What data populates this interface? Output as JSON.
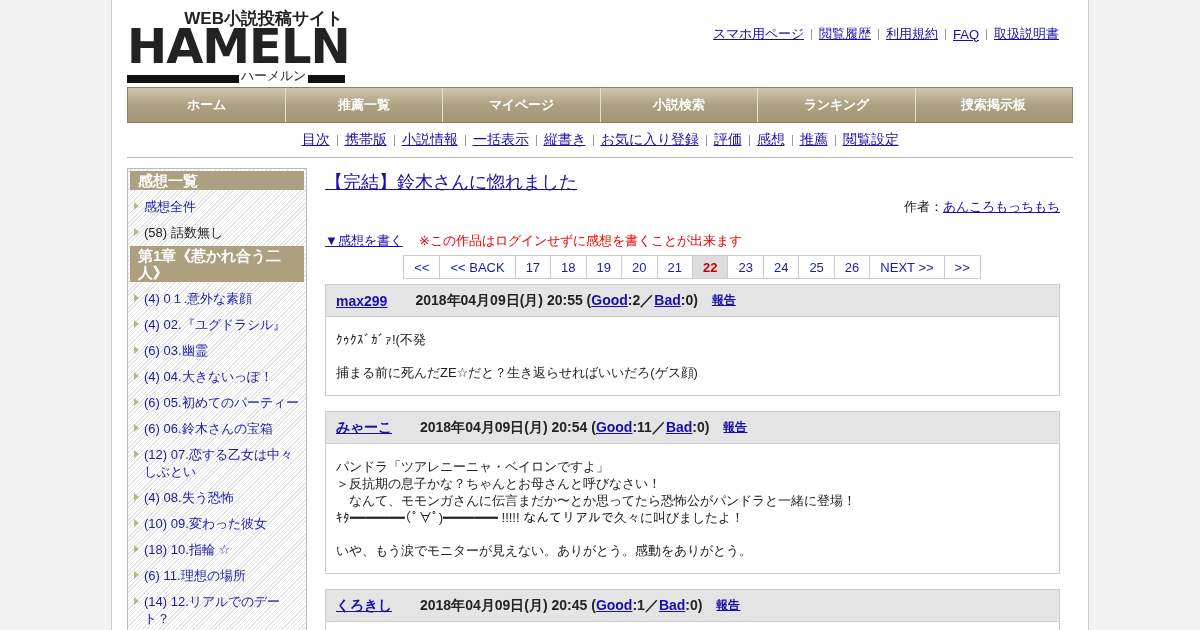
{
  "logo": {
    "tagline": "WEB小説投稿サイト",
    "name": "HAMELN",
    "reading": "ハーメルン"
  },
  "top_links": [
    "スマホ用ページ",
    "閲覧履歴",
    "利用規約",
    "FAQ",
    "取扱説明書"
  ],
  "nav": [
    "ホーム",
    "推薦一覧",
    "マイページ",
    "小説検索",
    "ランキング",
    "捜索掲示板"
  ],
  "sub_nav": [
    "目次",
    "携帯版",
    "小説情報",
    "一括表示",
    "縦書き",
    "お気に入り登録",
    "評価",
    "感想",
    "推薦",
    "閲覧設定"
  ],
  "sidebar": [
    {
      "heading": "感想一覧",
      "items": [
        {
          "text": "感想全件",
          "link": true
        },
        {
          "text": "(58) 話数無し",
          "link": false
        }
      ]
    },
    {
      "heading": "第1章《惹かれ合う二人》",
      "items": [
        {
          "text": "(4) 0１.意外な素顔",
          "link": true
        },
        {
          "text": "(4) 02.『ユグドラシル』",
          "link": true
        },
        {
          "text": "(6) 03.幽霊",
          "link": true
        },
        {
          "text": "(4) 04.大きないっぽ！",
          "link": true
        },
        {
          "text": "(6) 05.初めてのパーティー",
          "link": true
        },
        {
          "text": "(6) 06.鈴木さんの宝箱",
          "link": true
        },
        {
          "text": "(12) 07.恋する乙女は中々しぶとい",
          "link": true
        },
        {
          "text": "(4) 08.失う恐怖",
          "link": true
        },
        {
          "text": "(10) 09.変わった彼女",
          "link": true
        },
        {
          "text": "(18) 10.指輪 ☆",
          "link": true
        },
        {
          "text": "(6) 11.理想の場所",
          "link": true
        },
        {
          "text": "(14) 12.リアルでのデート？",
          "link": true
        }
      ]
    }
  ],
  "title": "【完結】鈴木さんに惚れました",
  "author_label": "作者：",
  "author": "あんころもっちもち",
  "write_link": "▼感想を書く",
  "notice": "※この作品はログインせずに感想を書くことが出来ます",
  "pagination": [
    {
      "label": "<<",
      "selected": false
    },
    {
      "label": "<< BACK",
      "selected": false
    },
    {
      "label": "17",
      "selected": false
    },
    {
      "label": "18",
      "selected": false
    },
    {
      "label": "19",
      "selected": false
    },
    {
      "label": "20",
      "selected": false
    },
    {
      "label": "21",
      "selected": false
    },
    {
      "label": "22",
      "selected": true
    },
    {
      "label": "23",
      "selected": false
    },
    {
      "label": "24",
      "selected": false
    },
    {
      "label": "25",
      "selected": false
    },
    {
      "label": "26",
      "selected": false
    },
    {
      "label": "NEXT >>",
      "selected": false
    },
    {
      "label": ">>",
      "selected": false
    }
  ],
  "comments": [
    {
      "user": "max299",
      "meta": [
        {
          "kind": "text",
          "text": "2018年04月09日(月) 20:55 ("
        },
        {
          "kind": "link",
          "text": "Good"
        },
        {
          "kind": "text",
          "text": ":2／"
        },
        {
          "kind": "link",
          "text": "Bad"
        },
        {
          "kind": "text",
          "text": ":0)"
        }
      ],
      "report": "報告",
      "body": [
        [
          "ｸｩｸｽﾞｶﾞｧ!(不発"
        ],
        [
          "捕まる前に死んだZE☆だと？生き返らせればいいだろ(ゲス顔)"
        ]
      ]
    },
    {
      "user": "みゃーこ",
      "meta": [
        {
          "kind": "text",
          "text": "2018年04月09日(月) 20:54 ("
        },
        {
          "kind": "link",
          "text": "Good"
        },
        {
          "kind": "text",
          "text": ":11／"
        },
        {
          "kind": "link",
          "text": "Bad"
        },
        {
          "kind": "text",
          "text": ":0)"
        }
      ],
      "report": "報告",
      "body": [
        [
          "パンドラ「ツアレニーニャ・ベイロンですよ」",
          "＞反抗期の息子かな？ちゃんとお母さんと呼びなさい！",
          "　なんて、モモンガさんに伝言まだか〜とか思ってたら恐怖公がパンドラと一緒に登場！",
          "ｷﾀ━━━━━━━(ﾟ∀ﾟ)━━━━━━━ !!!!! なんてリアルで久々に叫びましたよ！"
        ],
        [
          "いや、もう涙でモニターが見えない。ありがとう。感動をありがとう。"
        ]
      ]
    },
    {
      "user": "くろきし",
      "meta": [
        {
          "kind": "text",
          "text": "2018年04月09日(月) 20:45 ("
        },
        {
          "kind": "link",
          "text": "Good"
        },
        {
          "kind": "text",
          "text": ":1／"
        },
        {
          "kind": "link",
          "text": "Bad"
        },
        {
          "kind": "text",
          "text": ":0)"
        }
      ],
      "report": "報告"
    }
  ]
}
